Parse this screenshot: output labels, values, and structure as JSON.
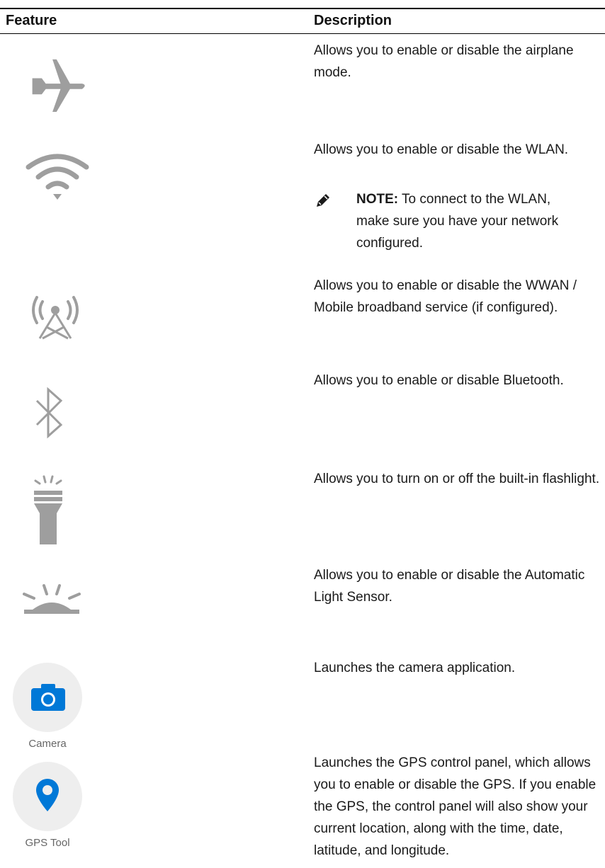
{
  "table": {
    "headers": {
      "feature": "Feature",
      "description": "Description"
    },
    "rows": [
      {
        "icon": "airplane-icon",
        "description": "Allows you to enable or disable the airplane mode."
      },
      {
        "icon": "wifi-icon",
        "description": "Allows you to enable or disable the WLAN.",
        "note": {
          "label": "NOTE:",
          "text": "To connect to the WLAN, make sure you have your network configured."
        }
      },
      {
        "icon": "cellular-tower-icon",
        "description": "Allows you to enable or disable the WWAN / Mobile broadband service (if configured)."
      },
      {
        "icon": "bluetooth-icon",
        "description": "Allows you to enable or disable Bluetooth."
      },
      {
        "icon": "flashlight-icon",
        "description": "Allows you to turn on or off the built-in flashlight."
      },
      {
        "icon": "light-sensor-icon",
        "description": "Allows you to enable or disable the Automatic Light Sensor."
      },
      {
        "icon": "camera-icon",
        "icon_label": "Camera",
        "description": "Launches the camera application."
      },
      {
        "icon": "gps-pin-icon",
        "icon_label": "GPS Tool",
        "description": "Launches the GPS control panel, which allows you to enable or disable the GPS. If you enable the GPS, the control panel will also show your current location, along with the time, date, latitude, and longitude."
      }
    ]
  },
  "colors": {
    "icon_gray": "#9e9e9e",
    "app_blue": "#0078d7",
    "app_circle": "#eeeeee"
  }
}
